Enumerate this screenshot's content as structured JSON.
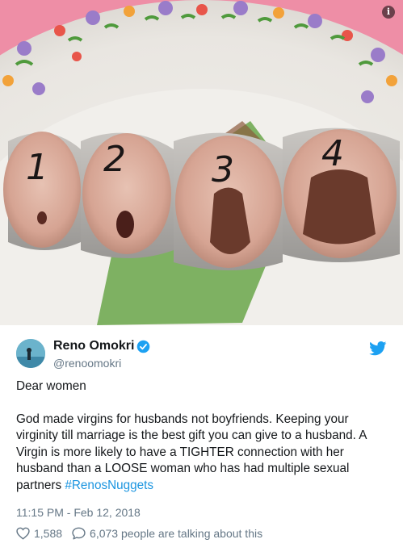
{
  "image": {
    "alt": "",
    "numbers": [
      "1",
      "2",
      "3",
      "4"
    ],
    "info_icon": "info-icon"
  },
  "tweet": {
    "display_name": "Reno Omokri",
    "handle": "@renoomokri",
    "verified_icon": "verified-badge-icon",
    "brand_icon": "twitter-bird-icon",
    "greeting": "Dear women",
    "body": "God made virgins for husbands not boyfriends. Keeping your virginity till marriage is the best gift you can give to a husband. A Virgin is more likely to have a TIGHTER connection with her husband than a LOOSE woman who has had multiple sexual partners ",
    "hashtag": "#RenosNuggets",
    "timestamp": "11:15 PM - Feb 12, 2018",
    "like_count": "1,588",
    "talking_text": "6,073 people are talking about this"
  },
  "colors": {
    "link": "#1b95e0",
    "muted": "#657786",
    "text": "#14171a"
  }
}
